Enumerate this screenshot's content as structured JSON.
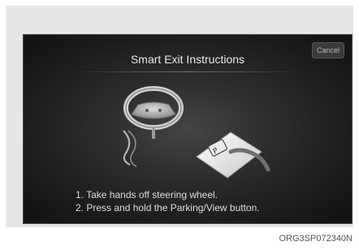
{
  "screen": {
    "title": "Smart Exit Instructions",
    "cancel_label": "Cancel",
    "instructions": [
      "1. Take hands off steering wheel.",
      "2. Press and hold the Parking/View button."
    ]
  },
  "figure_code": "ORG3SP072340N",
  "icons": [
    "steering-wheel-icon",
    "hand-icon",
    "parking-view-button-icon",
    "finger-icon"
  ]
}
